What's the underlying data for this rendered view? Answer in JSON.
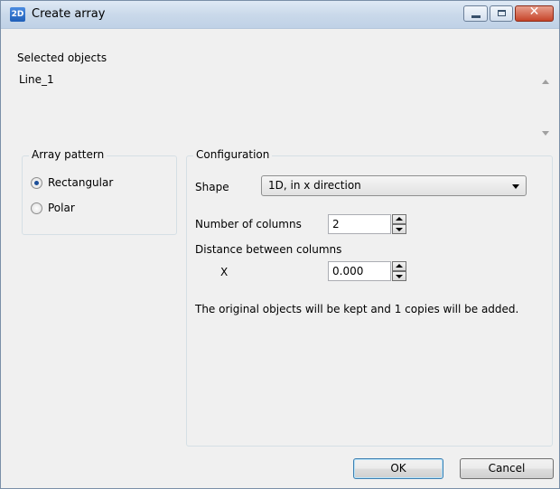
{
  "window": {
    "title": "Create array",
    "icon_text": "2D",
    "icon": "app-2d-icon"
  },
  "titlebar_buttons": [
    "minimize-icon",
    "maximize-icon",
    "close-icon"
  ],
  "selected_objects": {
    "label": "Selected objects",
    "items": [
      "Line_1"
    ]
  },
  "array_pattern": {
    "title": "Array pattern",
    "options": [
      {
        "label": "Rectangular",
        "checked": true
      },
      {
        "label": "Polar",
        "checked": false
      }
    ]
  },
  "configuration": {
    "title": "Configuration",
    "shape_label": "Shape",
    "shape_value": "1D, in x direction",
    "columns_label": "Number of columns",
    "columns_value": "2",
    "distance_label": "Distance between columns",
    "x_label": "X",
    "x_value": "0.000",
    "message": "The original objects will be kept and 1 copies will be added."
  },
  "buttons": {
    "ok": "OK",
    "cancel": "Cancel"
  },
  "colors": {
    "title_bar": "#cad9ea",
    "close_button": "#c64429",
    "dialog_bg": "#f0f0f0"
  }
}
